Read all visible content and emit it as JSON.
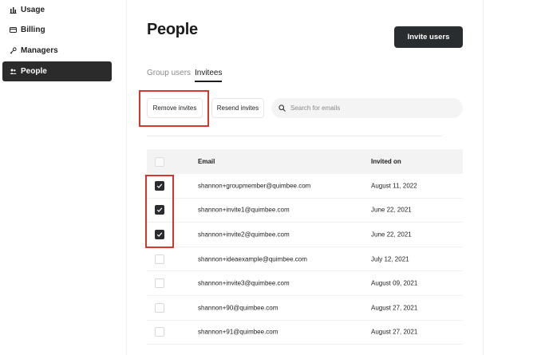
{
  "sidebar": {
    "items": [
      {
        "label": "Usage",
        "icon": "bar-chart-icon",
        "active": false
      },
      {
        "label": "Billing",
        "icon": "credit-card-icon",
        "active": false
      },
      {
        "label": "Managers",
        "icon": "key-icon",
        "active": false
      },
      {
        "label": "People",
        "icon": "people-icon",
        "active": true
      }
    ]
  },
  "header": {
    "title": "People",
    "invite_button": "Invite users"
  },
  "tabs": [
    {
      "label": "Group users",
      "active": false
    },
    {
      "label": "Invitees",
      "active": true
    }
  ],
  "toolbar": {
    "remove_label": "Remove invites",
    "resend_label": "Resend invites",
    "search_placeholder": "Search for emails"
  },
  "table": {
    "columns": {
      "email": "Email",
      "invited_on": "Invited on"
    },
    "rows": [
      {
        "email": "shannon+groupmember@quimbee.com",
        "invited_on": "August 11, 2022",
        "checked": true
      },
      {
        "email": "shannon+invite1@quimbee.com",
        "invited_on": "June 22, 2021",
        "checked": true
      },
      {
        "email": "shannon+invite2@quimbee.com",
        "invited_on": "June 22, 2021",
        "checked": true
      },
      {
        "email": "shannon+ideaexample@quimbee.com",
        "invited_on": "July 12, 2021",
        "checked": false
      },
      {
        "email": "shannon+invite3@quimbee.com",
        "invited_on": "August 09, 2021",
        "checked": false
      },
      {
        "email": "shannon+90@quimbee.com",
        "invited_on": "August 27, 2021",
        "checked": false
      },
      {
        "email": "shannon+91@quimbee.com",
        "invited_on": "August 27, 2021",
        "checked": false
      }
    ]
  },
  "colors": {
    "accent_dark": "#2a2d30",
    "highlight_red": "#d9352d"
  }
}
